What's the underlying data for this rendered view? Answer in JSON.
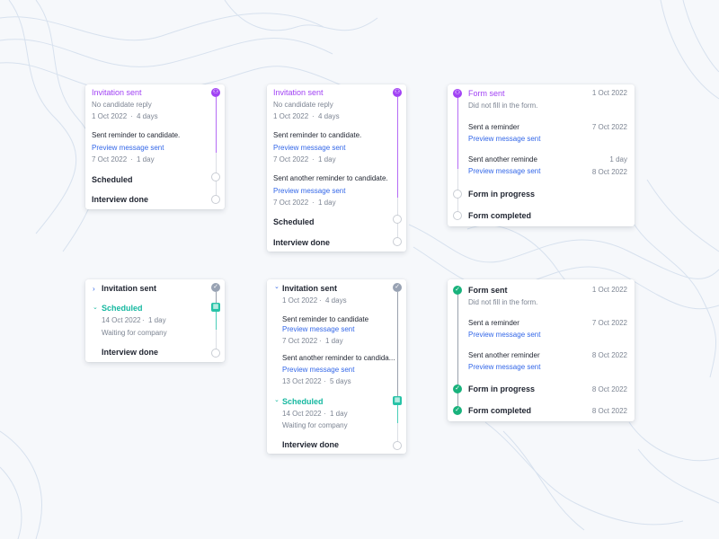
{
  "icons": {
    "person": "person-icon",
    "check": "check-icon",
    "calendar": "calendar-icon"
  },
  "colors": {
    "purple": "#a142f4",
    "teal": "#16b8a0",
    "link": "#3367e8",
    "green": "#19b27c"
  },
  "card1": {
    "title": "Invitation sent",
    "subtitle": "No candidate reply",
    "date": "1 Oct 2022",
    "duration": "4 days",
    "reminder": "Sent reminder to candidate.",
    "preview": "Preview message sent",
    "reminder_date": "7 Oct 2022",
    "reminder_duration": "1 day",
    "scheduled": "Scheduled",
    "interview": "Interview done"
  },
  "card2": {
    "title": "Invitation sent",
    "subtitle": "No candidate reply",
    "date": "1 Oct 2022",
    "duration": "4 days",
    "reminder1": "Sent reminder to candidate.",
    "preview1": "Preview message sent",
    "reminder1_date": "7 Oct 2022",
    "reminder1_duration": "1 day",
    "reminder2": "Sent another reminder to candidate.",
    "preview2": "Preview message sent",
    "reminder2_date": "7 Oct 2022",
    "reminder2_duration": "1 day",
    "scheduled": "Scheduled",
    "interview": "Interview done"
  },
  "card3": {
    "title": "Form sent",
    "title_date": "1 Oct 2022",
    "subtitle": "Did not fill in the form.",
    "reminder1": "Sent a reminder",
    "reminder1_date": "7 Oct 2022",
    "preview1": "Preview message sent",
    "reminder2": "Sent another reminde",
    "reminder2_duration": "1 day",
    "preview2": "Preview message sent",
    "reminder2_date": "8 Oct 2022",
    "in_progress": "Form in progress",
    "completed": "Form completed"
  },
  "card4": {
    "invitation": "Invitation sent",
    "scheduled": "Scheduled",
    "date": "14 Oct 2022",
    "duration": "1 day",
    "note": "Waiting for company",
    "interview": "Interview done"
  },
  "card5": {
    "invitation": "Invitation sent",
    "date": "1 Oct 2022",
    "duration": "4 days",
    "reminder1": "Sent reminder to candidate",
    "preview1": "Preview message sent",
    "reminder1_date": "7 Oct 2022",
    "reminder1_duration": "1 day",
    "reminder2": "Sent another reminder to candida...",
    "preview2": "Preview message sent",
    "reminder2_date": "13 Oct 2022",
    "reminder2_duration": "5 days",
    "scheduled": "Scheduled",
    "sched_date": "14 Oct 2022",
    "sched_duration": "1 day",
    "note": "Waiting for company",
    "interview": "Interview done"
  },
  "card6": {
    "title": "Form sent",
    "title_date": "1 Oct 2022",
    "subtitle": "Did not fill in the form.",
    "reminder1": "Sent a reminder",
    "reminder1_date": "7 Oct 2022",
    "preview1": "Preview message sent",
    "reminder2": "Sent another reminder",
    "reminder2_date": "8 Oct 2022",
    "preview2": "Preview message sent",
    "in_progress": "Form in progress",
    "in_progress_date": "8 Oct 2022",
    "completed": "Form completed",
    "completed_date": "8 Oct 2022"
  },
  "sep": "·"
}
